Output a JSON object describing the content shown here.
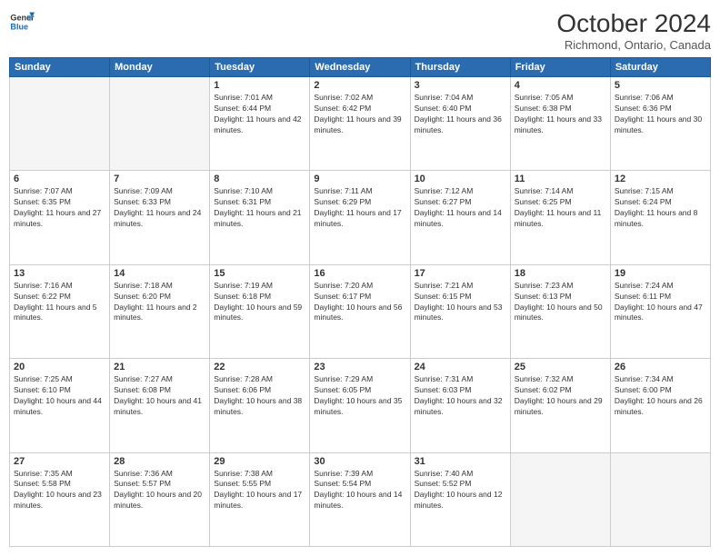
{
  "header": {
    "logo_line1": "General",
    "logo_line2": "Blue",
    "month": "October 2024",
    "location": "Richmond, Ontario, Canada"
  },
  "weekdays": [
    "Sunday",
    "Monday",
    "Tuesday",
    "Wednesday",
    "Thursday",
    "Friday",
    "Saturday"
  ],
  "weeks": [
    [
      {
        "day": "",
        "empty": true
      },
      {
        "day": "",
        "empty": true
      },
      {
        "day": "1",
        "info": "Sunrise: 7:01 AM\nSunset: 6:44 PM\nDaylight: 11 hours and 42 minutes."
      },
      {
        "day": "2",
        "info": "Sunrise: 7:02 AM\nSunset: 6:42 PM\nDaylight: 11 hours and 39 minutes."
      },
      {
        "day": "3",
        "info": "Sunrise: 7:04 AM\nSunset: 6:40 PM\nDaylight: 11 hours and 36 minutes."
      },
      {
        "day": "4",
        "info": "Sunrise: 7:05 AM\nSunset: 6:38 PM\nDaylight: 11 hours and 33 minutes."
      },
      {
        "day": "5",
        "info": "Sunrise: 7:06 AM\nSunset: 6:36 PM\nDaylight: 11 hours and 30 minutes."
      }
    ],
    [
      {
        "day": "6",
        "info": "Sunrise: 7:07 AM\nSunset: 6:35 PM\nDaylight: 11 hours and 27 minutes."
      },
      {
        "day": "7",
        "info": "Sunrise: 7:09 AM\nSunset: 6:33 PM\nDaylight: 11 hours and 24 minutes."
      },
      {
        "day": "8",
        "info": "Sunrise: 7:10 AM\nSunset: 6:31 PM\nDaylight: 11 hours and 21 minutes."
      },
      {
        "day": "9",
        "info": "Sunrise: 7:11 AM\nSunset: 6:29 PM\nDaylight: 11 hours and 17 minutes."
      },
      {
        "day": "10",
        "info": "Sunrise: 7:12 AM\nSunset: 6:27 PM\nDaylight: 11 hours and 14 minutes."
      },
      {
        "day": "11",
        "info": "Sunrise: 7:14 AM\nSunset: 6:25 PM\nDaylight: 11 hours and 11 minutes."
      },
      {
        "day": "12",
        "info": "Sunrise: 7:15 AM\nSunset: 6:24 PM\nDaylight: 11 hours and 8 minutes."
      }
    ],
    [
      {
        "day": "13",
        "info": "Sunrise: 7:16 AM\nSunset: 6:22 PM\nDaylight: 11 hours and 5 minutes."
      },
      {
        "day": "14",
        "info": "Sunrise: 7:18 AM\nSunset: 6:20 PM\nDaylight: 11 hours and 2 minutes."
      },
      {
        "day": "15",
        "info": "Sunrise: 7:19 AM\nSunset: 6:18 PM\nDaylight: 10 hours and 59 minutes."
      },
      {
        "day": "16",
        "info": "Sunrise: 7:20 AM\nSunset: 6:17 PM\nDaylight: 10 hours and 56 minutes."
      },
      {
        "day": "17",
        "info": "Sunrise: 7:21 AM\nSunset: 6:15 PM\nDaylight: 10 hours and 53 minutes."
      },
      {
        "day": "18",
        "info": "Sunrise: 7:23 AM\nSunset: 6:13 PM\nDaylight: 10 hours and 50 minutes."
      },
      {
        "day": "19",
        "info": "Sunrise: 7:24 AM\nSunset: 6:11 PM\nDaylight: 10 hours and 47 minutes."
      }
    ],
    [
      {
        "day": "20",
        "info": "Sunrise: 7:25 AM\nSunset: 6:10 PM\nDaylight: 10 hours and 44 minutes."
      },
      {
        "day": "21",
        "info": "Sunrise: 7:27 AM\nSunset: 6:08 PM\nDaylight: 10 hours and 41 minutes."
      },
      {
        "day": "22",
        "info": "Sunrise: 7:28 AM\nSunset: 6:06 PM\nDaylight: 10 hours and 38 minutes."
      },
      {
        "day": "23",
        "info": "Sunrise: 7:29 AM\nSunset: 6:05 PM\nDaylight: 10 hours and 35 minutes."
      },
      {
        "day": "24",
        "info": "Sunrise: 7:31 AM\nSunset: 6:03 PM\nDaylight: 10 hours and 32 minutes."
      },
      {
        "day": "25",
        "info": "Sunrise: 7:32 AM\nSunset: 6:02 PM\nDaylight: 10 hours and 29 minutes."
      },
      {
        "day": "26",
        "info": "Sunrise: 7:34 AM\nSunset: 6:00 PM\nDaylight: 10 hours and 26 minutes."
      }
    ],
    [
      {
        "day": "27",
        "info": "Sunrise: 7:35 AM\nSunset: 5:58 PM\nDaylight: 10 hours and 23 minutes."
      },
      {
        "day": "28",
        "info": "Sunrise: 7:36 AM\nSunset: 5:57 PM\nDaylight: 10 hours and 20 minutes."
      },
      {
        "day": "29",
        "info": "Sunrise: 7:38 AM\nSunset: 5:55 PM\nDaylight: 10 hours and 17 minutes."
      },
      {
        "day": "30",
        "info": "Sunrise: 7:39 AM\nSunset: 5:54 PM\nDaylight: 10 hours and 14 minutes."
      },
      {
        "day": "31",
        "info": "Sunrise: 7:40 AM\nSunset: 5:52 PM\nDaylight: 10 hours and 12 minutes."
      },
      {
        "day": "",
        "empty": true
      },
      {
        "day": "",
        "empty": true
      }
    ]
  ]
}
